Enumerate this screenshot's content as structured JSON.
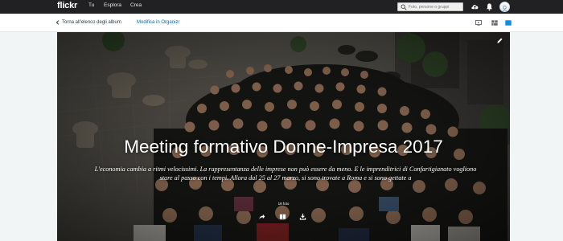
{
  "brand": {
    "name": "flickr"
  },
  "nav": {
    "items": [
      "Tu",
      "Esplora",
      "Crea"
    ]
  },
  "search": {
    "placeholder": "Foto, persone o gruppi"
  },
  "subnav": {
    "back_label": "Torna all'elenco degli album",
    "organizr_label": "Modifica in Organizr"
  },
  "album": {
    "title": "Meeting formativo Donne-Impresa 2017",
    "description": "L'economia cambia a ritmi velocissimi. La rappresentanza delle imprese non può essere da meno. E le imprenditrici di Confartigianato vogliono stare al passo con i tempi. Allora dal 25 al 27 marzo, si sono trovate a Roma e si sono gettate a",
    "photo_count": "18 foto"
  },
  "icons": {
    "search": "search-icon",
    "upload": "cloud-upload-icon",
    "notifications": "bell-icon",
    "avatar": "avatar",
    "edit": "pencil-icon",
    "share": "share-icon",
    "book": "book-icon",
    "download": "download-icon"
  },
  "colors": {
    "topbar": "#212124",
    "link": "#006dac",
    "accent": "#0a8ce5"
  }
}
